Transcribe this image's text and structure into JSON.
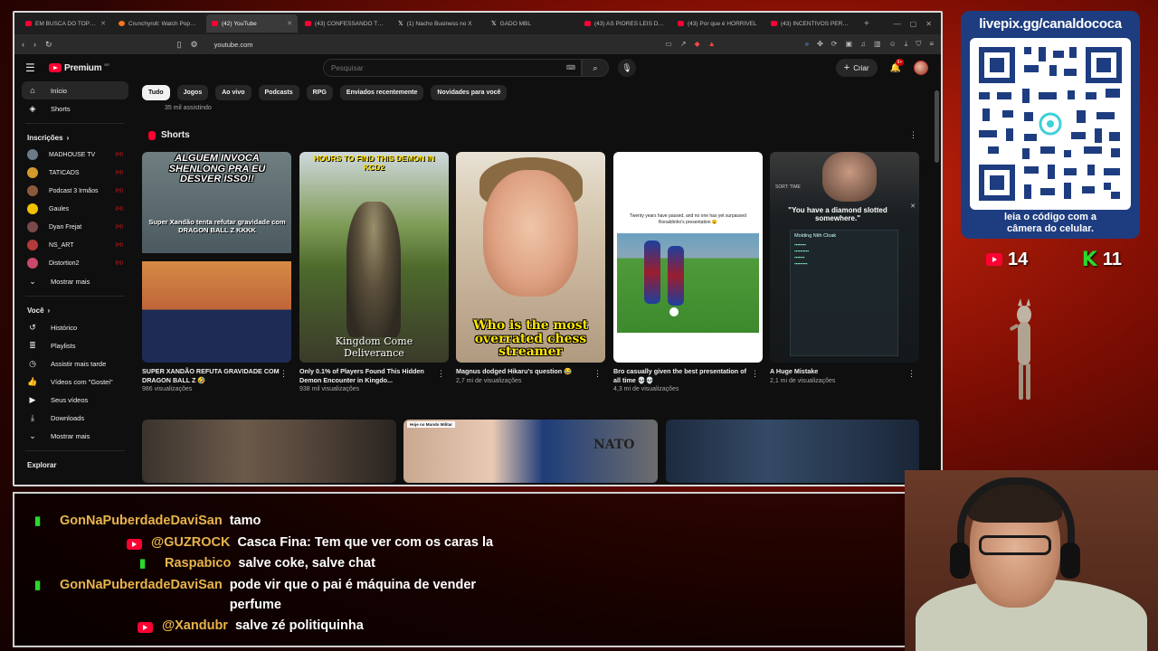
{
  "browser": {
    "tabs": [
      {
        "title": "EM BUSCA DO TOP 1 DO",
        "icon": "youtube-icon",
        "active": false
      },
      {
        "title": "Crunchyroll: Watch Popular",
        "icon": "crunchyroll-icon",
        "active": false
      },
      {
        "title": "(42) YouTube",
        "icon": "youtube-icon",
        "active": true
      },
      {
        "title": "(43) CONFESSANDO TOD",
        "icon": "youtube-icon",
        "active": false
      },
      {
        "title": "(1) Nacho Business no X",
        "icon": "x-icon",
        "active": false
      },
      {
        "title": "GADO MBL",
        "icon": "x-icon",
        "active": false
      },
      {
        "title": "(43) AS PIORES LEIS DO B",
        "icon": "youtube-icon",
        "active": false
      },
      {
        "title": "(43) Por que é HORRÍVEL",
        "icon": "youtube-icon",
        "active": false
      },
      {
        "title": "(43) INCENTIVOS PERVER",
        "icon": "youtube-icon",
        "active": false
      }
    ],
    "url": "youtube.com"
  },
  "youtube": {
    "logo_text": "Premium",
    "logo_sup": "BR",
    "search_placeholder": "Pesquisar",
    "create_label": "Criar",
    "notif_count": "9+",
    "sidebar": {
      "main": [
        {
          "label": "Início",
          "icon": "home-icon",
          "active": true
        },
        {
          "label": "Shorts",
          "icon": "shorts-icon",
          "active": false
        }
      ],
      "subs_header": "Inscrições",
      "subs": [
        {
          "name": "MADHOUSE TV",
          "color": "#6a7a8a"
        },
        {
          "name": "TATICADS",
          "color": "#d49a2a"
        },
        {
          "name": "Podcast 3 Irmãos",
          "color": "#8a5a3a"
        },
        {
          "name": "Gaules",
          "color": "#f2c200"
        },
        {
          "name": "Dyan Frejat",
          "color": "#7a4a4a"
        },
        {
          "name": "NS_ART",
          "color": "#b23a3a"
        },
        {
          "name": "Distortion2",
          "color": "#c84a6a"
        }
      ],
      "subs_more": "Mostrar mais",
      "you_header": "Você",
      "you": [
        {
          "label": "Histórico",
          "icon": "history-icon"
        },
        {
          "label": "Playlists",
          "icon": "playlists-icon"
        },
        {
          "label": "Assistir mais tarde",
          "icon": "watch-later-icon"
        },
        {
          "label": "Vídeos com \"Gostei\"",
          "icon": "like-icon"
        },
        {
          "label": "Seus vídeos",
          "icon": "your-videos-icon"
        },
        {
          "label": "Downloads",
          "icon": "download-icon"
        }
      ],
      "you_more": "Mostrar mais",
      "explore_header": "Explorar"
    },
    "chips": [
      "Tudo",
      "Jogos",
      "Ao vivo",
      "Podcasts",
      "RPG",
      "Enviados recentemente",
      "Novidades para você"
    ],
    "watching": "35 mil assistindo",
    "shorts_header": "Shorts",
    "shorts": [
      {
        "title": "SUPER XANDÃO REFUTA GRAVIDADE COM DRAGON BALL Z 🤣",
        "views": "986 visualizações",
        "overlay": "ALGUEM INVOCA SHENLONG PRA EU DESVER ISSO!!",
        "overlay2": "Super Xandão tenta refutar gravidade com DRAGON BALL Z KKKK"
      },
      {
        "title": "Only 0.1% of Players Found This Hidden Demon Encounter in Kingdo...",
        "views": "938 mil visualizações",
        "overlay": "HOURS TO FIND THIS DEMON IN KCD2",
        "overlay2": "Kingdom Come Deliverance"
      },
      {
        "title": "Magnus dodged Hikaru's question 😂",
        "views": "2,7 mi de visualizações",
        "overlay": "Who is the most overrated chess streamer"
      },
      {
        "title": "Bro casually given the best presentation of all time 💀💀",
        "views": "4,3 mi de visualizações",
        "overlay": "Twenty years have passed, and no one has yet surpassed Ronaldinho's presentation 😮"
      },
      {
        "title": "A Huge Mistake",
        "views": "2,1 mi de visualizações",
        "overlay": "\"You have a diamond slotted somewhere.\"",
        "overlay2": "Molding Nith Cloak",
        "sort_label": "SORT: TIME"
      }
    ],
    "row2": [
      {
        "tag": ""
      },
      {
        "tag": "Hoje no Mundo Militar",
        "text": "NATO"
      },
      {
        "tag": ""
      }
    ]
  },
  "overlay": {
    "qr_url": "livepix.gg/canaldococa",
    "qr_caption_1": "leia o código com a",
    "qr_caption_2": "câmera do celular.",
    "youtube_count": "14",
    "kick_count": "11"
  },
  "chat": [
    {
      "platform": "kick",
      "user": "GonNaPuberdadeDaviSan",
      "text": "tamo"
    },
    {
      "platform": "youtube",
      "user": "@GUZROCK",
      "text": "Casca Fina: Tem que ver com os caras la"
    },
    {
      "platform": "kick",
      "user": "Raspabico",
      "text": "salve coke, salve chat"
    },
    {
      "platform": "kick",
      "user": "GonNaPuberdadeDaviSan",
      "text": "pode vir que o pai é máquina de vender perfume"
    },
    {
      "platform": "youtube",
      "user": "@Xandubr",
      "text": "salve zé politiquinha"
    }
  ],
  "colors": {
    "youtube_red": "#ff0033",
    "kick_green": "#2bd82b",
    "chat_user": "#e9b44c",
    "qr_panel": "#1e3d80"
  }
}
